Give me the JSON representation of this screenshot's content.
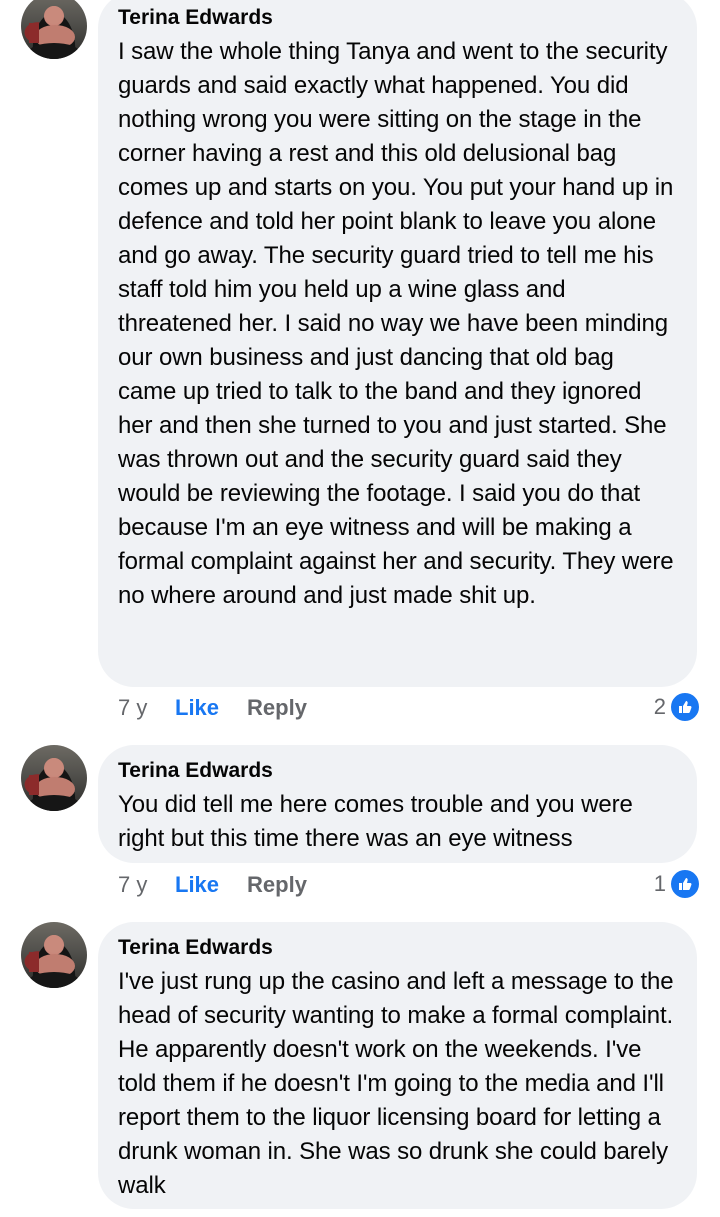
{
  "comments": [
    {
      "author": "Terina Edwards",
      "text": "I saw the whole thing Tanya and went to the security guards and said exactly what happened. You did nothing wrong you were sitting on the stage in the corner having a rest and this old delusional bag comes up and starts on you. You put your hand up in defence and told her point blank to leave you alone and go away. The security guard tried to tell me his staff told him you held up a wine glass and threatened her. I said no way we have been minding our own business and just dancing that old bag came up tried to talk to the band and they ignored her and then she turned to you and just started. She was thrown out and the security guard said they would be reviewing the footage. I said you do that because I'm an eye witness and will be making a formal complaint against her and security. They were no where around and just made shit up.",
      "time": "7 y",
      "like_label": "Like",
      "reply_label": "Reply",
      "reaction_count": "2"
    },
    {
      "author": "Terina Edwards",
      "text": "You did tell me here comes trouble and you were right but this time there was an eye witness",
      "time": "7 y",
      "like_label": "Like",
      "reply_label": "Reply",
      "reaction_count": "1"
    },
    {
      "author": "Terina Edwards",
      "text": "I've just rung up the casino and left a message to the head of security wanting to make a formal complaint. He apparently doesn't work on the weekends. I've told them if he doesn't I'm going to the media and I'll report them to the liquor licensing board for letting a drunk woman in. She was so drunk she could barely walk"
    }
  ],
  "colors": {
    "bubble": "#f0f2f5",
    "like_blue": "#1877f2",
    "meta_gray": "#65676b"
  },
  "icons": {
    "reaction": "thumbs-up-icon",
    "avatar": "profile-photo"
  }
}
